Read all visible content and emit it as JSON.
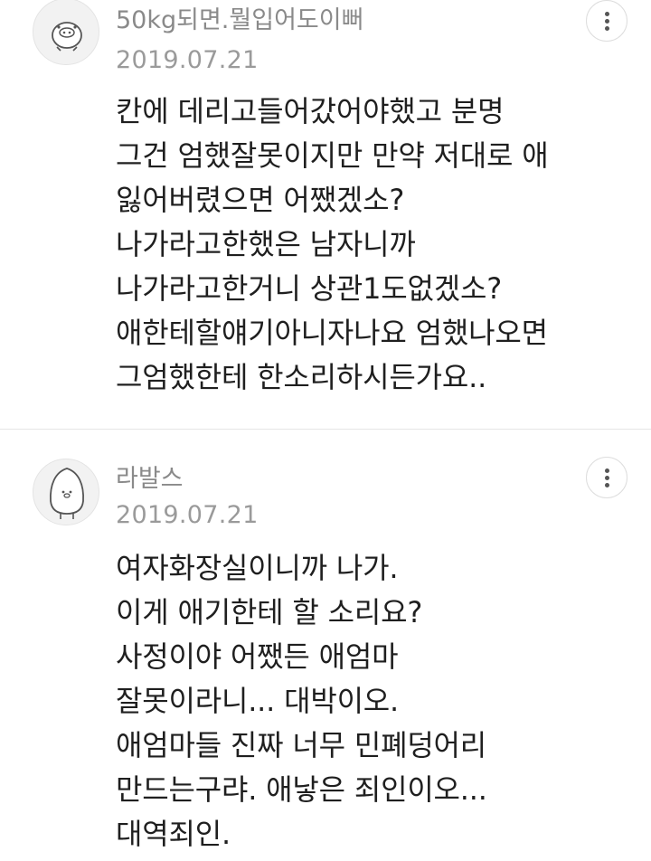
{
  "comments": [
    {
      "nickname": "50kg되면.뭘입어도이뻐",
      "date": "2019.07.21",
      "avatar_icon": "pig-character-icon",
      "lines": [
        "칸에 데리고들어갔어야했고 분명",
        "그건 엄했잘못이지만 만약 저대로 애",
        "잃어버렸으면 어쨌겠소?",
        "나가라고한했은 남자니까",
        "나가라고한거니 상관1도없겠소?",
        "애한테할얘기아니자나요 엄했나오면",
        "그엄했한테 한소리하시든가요.."
      ]
    },
    {
      "nickname": "라발스",
      "date": "2019.07.21",
      "avatar_icon": "penguin-character-icon",
      "lines": [
        "여자화장실이니까 나가.",
        "이게 애기한테 할 소리요?",
        "사정이야 어쨌든 애엄마",
        "잘못이라니... 대박이오.",
        "애엄마들 진짜 너무 민폐덩어리",
        "만드는구랴. 애낳은 죄인이오...",
        "대역죄인."
      ]
    }
  ],
  "colors": {
    "nickname": "#8a8a8a",
    "date": "#9a9a9a",
    "body_text": "#1f1f1f",
    "divider": "#e6e6e6"
  }
}
